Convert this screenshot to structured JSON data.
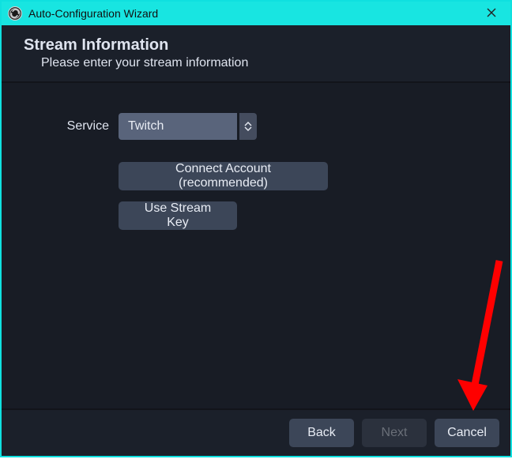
{
  "window": {
    "title": "Auto-Configuration Wizard"
  },
  "header": {
    "title": "Stream Information",
    "subtitle": "Please enter your stream information"
  },
  "form": {
    "service_label": "Service",
    "service_selected": "Twitch",
    "connect_button": "Connect Account (recommended)",
    "use_stream_key_button": "Use Stream Key"
  },
  "footer": {
    "back": "Back",
    "next": "Next",
    "cancel": "Cancel",
    "next_enabled": false
  },
  "annotation": {
    "arrow_target": "cancel-button",
    "color": "#ff0000"
  }
}
